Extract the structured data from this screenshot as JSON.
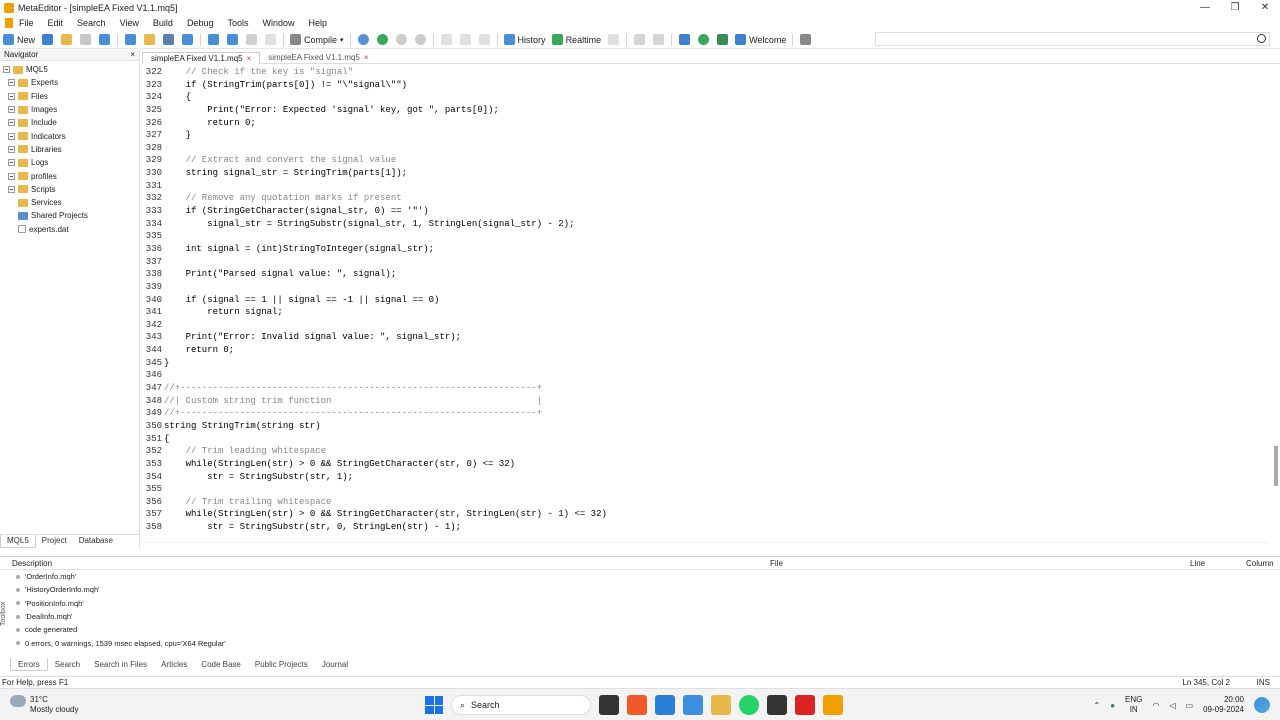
{
  "window": {
    "title": "MetaEditor - [simpleEA Fixed V1.1.mq5]"
  },
  "menu": [
    "File",
    "Edit",
    "Search",
    "View",
    "Build",
    "Debug",
    "Tools",
    "Window",
    "Help"
  ],
  "toolbar": {
    "new": "New",
    "compile": "Compile",
    "history": "History",
    "realtime": "Realtime",
    "welcome": "Welcome"
  },
  "navigator": {
    "title": "Navigator",
    "root": "MQL5",
    "items": [
      "Experts",
      "Files",
      "Images",
      "Include",
      "Indicators",
      "Libraries",
      "Logs",
      "profiles",
      "Scripts",
      "Services",
      "Shared Projects",
      "experts.dat"
    ],
    "tabs": [
      "MQL5",
      "Project",
      "Database"
    ]
  },
  "editor": {
    "tabs": [
      "simpleEA Fixed V1.1.mq5",
      "simpleEA Fixed V1.1.mq5"
    ],
    "lines": [
      {
        "n": "322",
        "t": "    // Check if the key is \"signal\""
      },
      {
        "n": "323",
        "t": "    if (StringTrim(parts[0]) != \"\\\"signal\\\"\")"
      },
      {
        "n": "324",
        "t": "    {"
      },
      {
        "n": "325",
        "t": "        Print(\"Error: Expected 'signal' key, got \", parts[0]);"
      },
      {
        "n": "326",
        "t": "        return 0;"
      },
      {
        "n": "327",
        "t": "    }"
      },
      {
        "n": "328",
        "t": ""
      },
      {
        "n": "329",
        "t": "    // Extract and convert the signal value"
      },
      {
        "n": "330",
        "t": "    string signal_str = StringTrim(parts[1]);"
      },
      {
        "n": "331",
        "t": ""
      },
      {
        "n": "332",
        "t": "    // Remove any quotation marks if present"
      },
      {
        "n": "333",
        "t": "    if (StringGetCharacter(signal_str, 0) == '\"')"
      },
      {
        "n": "334",
        "t": "        signal_str = StringSubstr(signal_str, 1, StringLen(signal_str) - 2);"
      },
      {
        "n": "335",
        "t": ""
      },
      {
        "n": "336",
        "t": "    int signal = (int)StringToInteger(signal_str);"
      },
      {
        "n": "337",
        "t": ""
      },
      {
        "n": "338",
        "t": "    Print(\"Parsed signal value: \", signal);"
      },
      {
        "n": "339",
        "t": ""
      },
      {
        "n": "340",
        "t": "    if (signal == 1 || signal == -1 || signal == 0)"
      },
      {
        "n": "341",
        "t": "        return signal;"
      },
      {
        "n": "342",
        "t": ""
      },
      {
        "n": "343",
        "t": "    Print(\"Error: Invalid signal value: \", signal_str);"
      },
      {
        "n": "344",
        "t": "    return 0;"
      },
      {
        "n": "345",
        "t": "}"
      },
      {
        "n": "346",
        "t": ""
      },
      {
        "n": "347",
        "t": "//+------------------------------------------------------------------+"
      },
      {
        "n": "348",
        "t": "//| Custom string trim function                                      |"
      },
      {
        "n": "349",
        "t": "//+------------------------------------------------------------------+"
      },
      {
        "n": "350",
        "t": "string StringTrim(string str)"
      },
      {
        "n": "351",
        "t": "{"
      },
      {
        "n": "352",
        "t": "    // Trim leading whitespace"
      },
      {
        "n": "353",
        "t": "    while(StringLen(str) > 0 && StringGetCharacter(str, 0) <= 32)"
      },
      {
        "n": "354",
        "t": "        str = StringSubstr(str, 1);"
      },
      {
        "n": "355",
        "t": ""
      },
      {
        "n": "356",
        "t": "    // Trim trailing whitespace"
      },
      {
        "n": "357",
        "t": "    while(StringLen(str) > 0 && StringGetCharacter(str, StringLen(str) - 1) <= 32)"
      },
      {
        "n": "358",
        "t": "        str = StringSubstr(str, 0, StringLen(str) - 1);"
      }
    ]
  },
  "toolbox": {
    "label": "Toolbox",
    "columns": {
      "description": "Description",
      "file": "File",
      "line": "Line",
      "column": "Column"
    },
    "messages": [
      "'OrderInfo.mqh'",
      "'HistoryOrderInfo.mqh'",
      "'PositionInfo.mqh'",
      "'DealInfo.mqh'",
      "code generated",
      "0 errors, 0 warnings, 1539 msec elapsed, cpu='X64 Regular'"
    ],
    "tabs": [
      "Errors",
      "Search",
      "Search in Files",
      "Articles",
      "Code Base",
      "Public Projects",
      "Journal"
    ]
  },
  "status": {
    "help": "For Help, press F1",
    "position": "Ln 345, Col 2",
    "mode": "INS"
  },
  "taskbar": {
    "temp": "31°C",
    "weather": "Mostly cloudy",
    "search": "Search",
    "lang1": "ENG",
    "lang2": "IN",
    "time": "20:00",
    "date": "09-09-2024"
  }
}
